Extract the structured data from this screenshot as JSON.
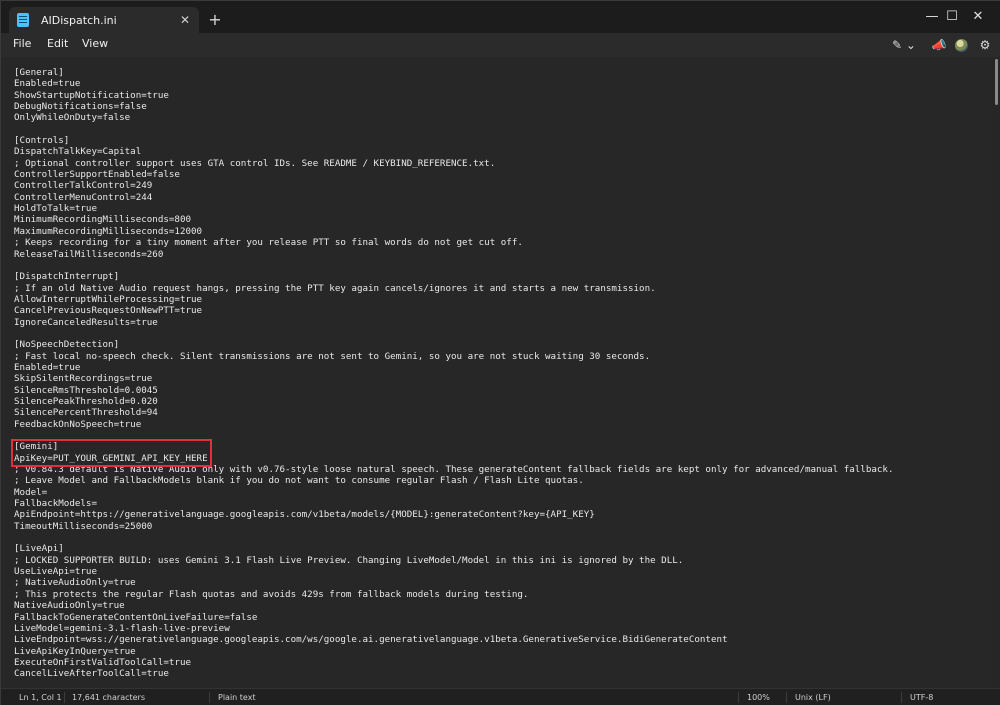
{
  "window": {
    "tab_title": "AIDispatch.ini",
    "new_tab_symbol": "+",
    "close_tab_symbol": "✕",
    "minimize_symbol": "—",
    "maximize_symbol": "☐",
    "close_symbol": "✕"
  },
  "menu": {
    "file": "File",
    "edit": "Edit",
    "view": "View"
  },
  "toolbar": {
    "copilot_icon": "✎ ⌄",
    "megaphone_icon": "📣",
    "gear_icon": "⚙"
  },
  "editor": {
    "lines": [
      "[General]",
      "Enabled=true",
      "ShowStartupNotification=true",
      "DebugNotifications=false",
      "OnlyWhileOnDuty=false",
      "",
      "[Controls]",
      "DispatchTalkKey=Capital",
      "; Optional controller support uses GTA control IDs. See README / KEYBIND_REFERENCE.txt.",
      "ControllerSupportEnabled=false",
      "ControllerTalkControl=249",
      "ControllerMenuControl=244",
      "HoldToTalk=true",
      "MinimumRecordingMilliseconds=800",
      "MaximumRecordingMilliseconds=12000",
      "; Keeps recording for a tiny moment after you release PTT so final words do not get cut off.",
      "ReleaseTailMilliseconds=260",
      "",
      "[DispatchInterrupt]",
      "; If an old Native Audio request hangs, pressing the PTT key again cancels/ignores it and starts a new transmission.",
      "AllowInterruptWhileProcessing=true",
      "CancelPreviousRequestOnNewPTT=true",
      "IgnoreCanceledResults=true",
      "",
      "[NoSpeechDetection]",
      "; Fast local no-speech check. Silent transmissions are not sent to Gemini, so you are not stuck waiting 30 seconds.",
      "Enabled=true",
      "SkipSilentRecordings=true",
      "SilenceRmsThreshold=0.0045",
      "SilencePeakThreshold=0.020",
      "SilencePercentThreshold=94",
      "FeedbackOnNoSpeech=true",
      "",
      "[Gemini]",
      "ApiKey=PUT_YOUR_GEMINI_API_KEY_HERE",
      "; v0.84.3 default is Native Audio only with v0.76-style loose natural speech. These generateContent fallback fields are kept only for advanced/manual fallback.",
      "; Leave Model and FallbackModels blank if you do not want to consume regular Flash / Flash Lite quotas.",
      "Model=",
      "FallbackModels=",
      "ApiEndpoint=https://generativelanguage.googleapis.com/v1beta/models/{MODEL}:generateContent?key={API_KEY}",
      "TimeoutMilliseconds=25000",
      "",
      "[LiveApi]",
      "; LOCKED SUPPORTER BUILD: uses Gemini 3.1 Flash Live Preview. Changing LiveModel/Model in this ini is ignored by the DLL.",
      "UseLiveApi=true",
      "; NativeAudioOnly=true",
      "; This protects the regular Flash quotas and avoids 429s from fallback models during testing.",
      "NativeAudioOnly=true",
      "FallbackToGenerateContentOnLiveFailure=false",
      "LiveModel=gemini-3.1-flash-live-preview",
      "LiveEndpoint=wss://generativelanguage.googleapis.com/ws/google.ai.generativelanguage.v1beta.GenerativeService.BidiGenerateContent",
      "LiveApiKeyInQuery=true",
      "ExecuteOnFirstValidToolCall=true",
      "CancelLiveAfterToolCall=true"
    ]
  },
  "status": {
    "position": "Ln 1, Col 1",
    "characters": "17,641 characters",
    "file_type": "Plain text",
    "zoom": "100%",
    "line_ending": "Unix (LF)",
    "encoding": "UTF-8"
  },
  "colors": {
    "highlight_box": "#e0303a",
    "accent": "#4cc2ff"
  }
}
